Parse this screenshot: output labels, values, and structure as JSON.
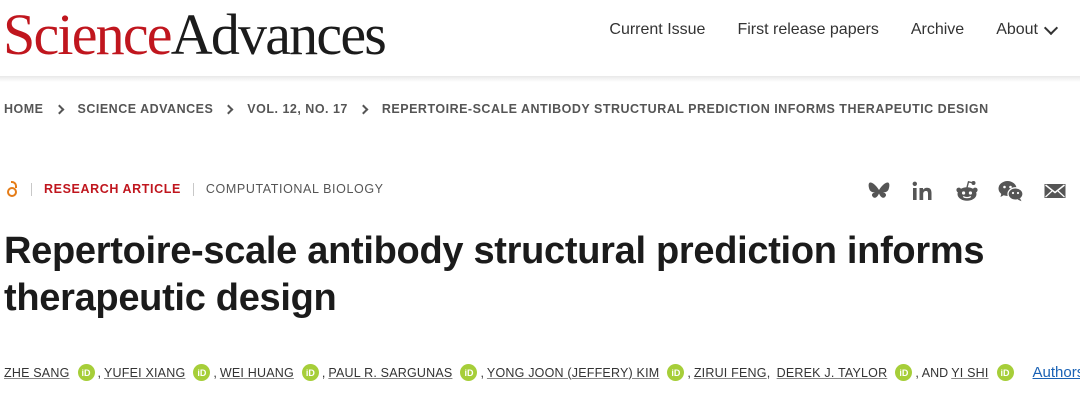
{
  "header": {
    "logo_part1": "Science",
    "logo_part2": "Advances",
    "nav": [
      "Current Issue",
      "First release papers",
      "Archive",
      "About"
    ]
  },
  "breadcrumb": [
    "HOME",
    "SCIENCE ADVANCES",
    "VOL. 12, NO. 17",
    "REPERTOIRE-SCALE ANTIBODY STRUCTURAL PREDICTION INFORMS THERAPEUTIC DESIGN"
  ],
  "meta": {
    "article_type": "RESEARCH ARTICLE",
    "subject": "COMPUTATIONAL BIOLOGY",
    "share_icons": [
      "bluesky-icon",
      "linkedin-icon",
      "reddit-icon",
      "wechat-icon",
      "email-icon"
    ]
  },
  "article": {
    "title": "Repertoire-scale antibody structural prediction informs therapeutic design"
  },
  "authors": {
    "names": [
      "ZHE SANG",
      "YUFEI XIANG",
      "WEI HUANG",
      "PAUL R. SARGUNAS",
      "YONG JOON (JEFFERY) KIM",
      "ZIRUI FENG",
      "DEREK J. TAYLOR",
      "YI SHI"
    ],
    "conjunction": "AND",
    "orcid_label": "iD",
    "authors_link": "Authors"
  },
  "colors": {
    "brand_red": "#c0161e",
    "orcid_green": "#a6ce39",
    "open_access_orange": "#e57c17",
    "link_blue": "#1a62b5"
  }
}
